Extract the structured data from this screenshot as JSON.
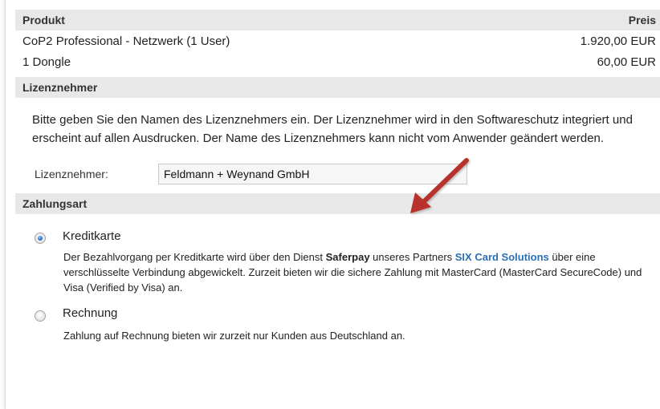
{
  "products": {
    "header": {
      "product_label": "Produkt",
      "price_label": "Preis"
    },
    "rows": [
      {
        "name": "CoP2 Professional - Netzwerk (1 User)",
        "price": "1.920,00 EUR"
      },
      {
        "name": "1 Dongle",
        "price": "60,00 EUR"
      }
    ]
  },
  "licensee": {
    "section_title": "Lizenznehmer",
    "description": "Bitte geben Sie den Namen des Lizenznehmers ein. Der Lizenznehmer wird in den Softwareschutz integriert und erscheint auf allen Ausdrucken. Der Name des Lizenznehmers kann nicht vom Anwender geändert werden.",
    "field_label": "Lizenznehmer:",
    "field_value": "Feldmann + Weynand GmbH"
  },
  "payment": {
    "section_title": "Zahlungsart",
    "options": [
      {
        "label": "Kreditkarte",
        "selected": true,
        "desc_part1": "Der Bezahlvorgang per Kreditkarte wird über den Dienst ",
        "desc_service": "Saferpay",
        "desc_part2": " unseres Partners ",
        "desc_partner": "SIX Card Solutions",
        "desc_part3": " über eine verschlüsselte Verbindung abgewickelt. Zurzeit bieten wir die sichere Zahlung mit MasterCard (MasterCard SecureCode) und Visa (Verified by Visa) an."
      },
      {
        "label": "Rechnung",
        "selected": false,
        "description": "Zahlung auf Rechnung bieten wir zurzeit nur Kunden aus Deutschland an."
      }
    ]
  },
  "colors": {
    "section_bg": "#e8e8e8",
    "link_blue": "#2d6fb4",
    "arrow_red": "#b7312c"
  }
}
